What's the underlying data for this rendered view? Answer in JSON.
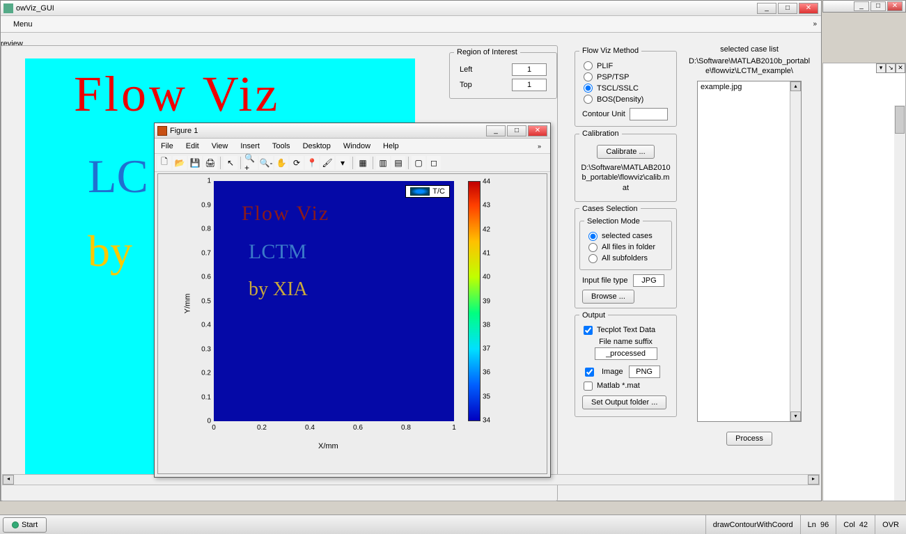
{
  "bg_window_controls": [
    "_",
    "□",
    "✕"
  ],
  "main": {
    "title": "owViz_GUI",
    "win_controls": [
      "_",
      "□",
      "✕"
    ],
    "menu": {
      "item": "Menu",
      "chevron": "»"
    },
    "preview": {
      "label": "review",
      "text1": "Flow   Viz",
      "text2": "LC",
      "text3": "by"
    },
    "roi": {
      "legend": "Region of Interest",
      "left_label": "Left",
      "left_val": "1",
      "top_label": "Top",
      "top_val": "1"
    },
    "flowviz": {
      "legend": "Flow Viz Method",
      "opt1": "PLIF",
      "opt2": "PSP/TSP",
      "opt3": "TSCL/SSLC",
      "opt4": "BOS(Density)",
      "contour_label": "Contour Unit",
      "contour_val": ""
    },
    "calib": {
      "legend": "Calibration",
      "btn": "Calibrate ...",
      "path": "D:\\Software\\MATLAB2010b_portable\\flowviz\\calib.mat"
    },
    "cases": {
      "legend": "Cases Selection",
      "mode_legend": "Selection Mode",
      "opt1": "selected cases",
      "opt2": "All files in folder",
      "opt3": "All subfolders",
      "filetype_label": "Input file type",
      "filetype_val": "JPG",
      "browse": "Browse ..."
    },
    "output": {
      "legend": "Output",
      "tecplot": "Tecplot Text Data",
      "suffix_label": "File name suffix",
      "suffix_val": "_processed",
      "image_label": "Image",
      "image_val": "PNG",
      "matlab": "Matlab *.mat",
      "setfolder": "Set Output folder ..."
    },
    "selected": {
      "label": "selected case list",
      "path": "D:\\Software\\MATLAB2010b_portable\\flowviz\\LCTM_example\\",
      "item": "example.jpg",
      "process": "Process"
    }
  },
  "figure": {
    "title": "Figure 1",
    "win_controls": [
      "_",
      "□",
      "✕"
    ],
    "menus": [
      "File",
      "Edit",
      "View",
      "Insert",
      "Tools",
      "Desktop",
      "Window",
      "Help"
    ],
    "toolbar_icons": [
      "new-file-icon",
      "open-file-icon",
      "save-icon",
      "print-icon",
      "|",
      "pointer-icon",
      "|",
      "zoom-in-icon",
      "zoom-out-icon",
      "pan-icon",
      "rotate-icon",
      "data-cursor-icon",
      "brush-icon",
      "link-icon",
      "|",
      "colorbar-icon",
      "|",
      "legend-icon",
      "subplot-icon",
      "|",
      "hide-icon",
      "dock-icon"
    ],
    "toolbar_glyphs": [
      "🗋",
      "📂",
      "💾",
      "🖨",
      "|",
      "↖",
      "|",
      "🔍+",
      "🔍-",
      "✋",
      "⟳",
      "📍",
      "🖌",
      "▾",
      "|",
      "▦",
      "|",
      "▥",
      "▤",
      "|",
      "▢",
      "◻"
    ],
    "text1": "Flow   Viz",
    "text2": "LCTM",
    "text3": "by  XIA",
    "legend_label": "T/C",
    "ylabel": "Y/mm",
    "xlabel": "X/mm"
  },
  "chart_data": {
    "type": "heatmap",
    "title": "",
    "xlabel": "X/mm",
    "ylabel": "Y/mm",
    "xlim": [
      0,
      1
    ],
    "ylim": [
      0,
      1
    ],
    "xticks": [
      0,
      0.2,
      0.4,
      0.6,
      0.8,
      1
    ],
    "yticks": [
      0,
      0.1,
      0.2,
      0.3,
      0.4,
      0.5,
      0.6,
      0.7,
      0.8,
      0.9,
      1
    ],
    "colorbar": {
      "label": "",
      "min": 34,
      "max": 44,
      "ticks": [
        34,
        35,
        36,
        37,
        38,
        39,
        40,
        41,
        42,
        43,
        44
      ]
    },
    "legend": [
      "T/C"
    ],
    "annotations": [
      "Flow   Viz",
      "LCTM",
      "by  XIA"
    ],
    "note": "Field appears uniform near low end (~34); overlaid text is part of source image, not data."
  },
  "taskbar": {
    "start": "Start",
    "status_fn": "drawContourWithCoord",
    "ln_label": "Ln",
    "ln": "96",
    "col_label": "Col",
    "col": "42",
    "ovr": "OVR"
  }
}
